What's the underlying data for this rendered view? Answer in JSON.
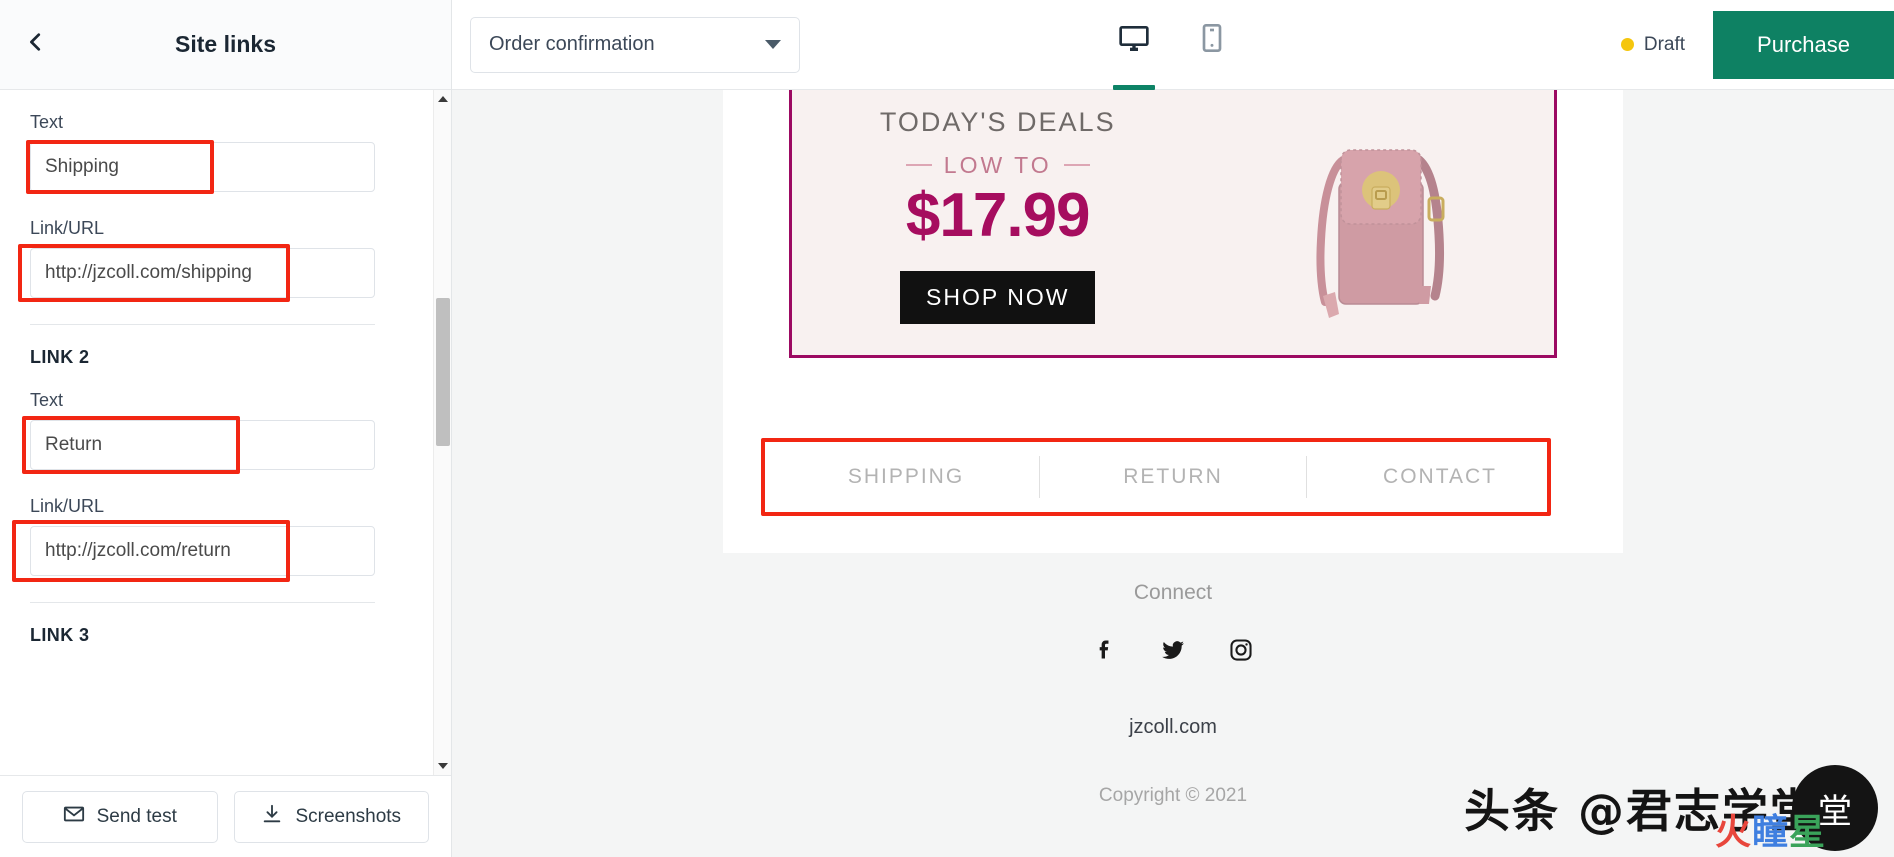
{
  "panel": {
    "title": "Site links",
    "back_icon": "chevron-left-icon",
    "fields": [
      {
        "label": "Text",
        "value": "Shipping"
      },
      {
        "label": "Link/URL",
        "value": "http://jzcoll.com/shipping"
      }
    ],
    "link2_heading": "LINK 2",
    "link2_fields": [
      {
        "label": "Text",
        "value": "Return"
      },
      {
        "label": "Link/URL",
        "value": "http://jzcoll.com/return"
      }
    ],
    "link3_heading": "LINK 3",
    "footer": {
      "send_test": "Send test",
      "send_test_icon": "envelope-icon",
      "screenshots": "Screenshots",
      "screenshots_icon": "download-icon"
    }
  },
  "toolbar": {
    "template_selected": "Order confirmation",
    "dropdown_icon": "chevron-down-icon",
    "desktop_icon": "desktop-icon",
    "mobile_icon": "mobile-icon",
    "status_label": "Draft",
    "status_color": "#f5c60d",
    "purchase_label": "Purchase",
    "purchase_color": "#0e8163",
    "active_indicator_color": "#0d8366"
  },
  "preview": {
    "banner": {
      "headline": "TODAY'S DEALS",
      "subhead": "LOW  TO",
      "price": "$17.99",
      "cta": "SHOP NOW",
      "border_color": "#9c0a62",
      "bg_color": "#f8f1f0",
      "product_alt": "pink-crossbody-bag"
    },
    "footer_links": [
      "SHIPPING",
      "RETURN",
      "CONTACT"
    ],
    "connect_label": "Connect",
    "social": [
      {
        "name": "facebook-icon"
      },
      {
        "name": "twitter-icon"
      },
      {
        "name": "instagram-icon"
      }
    ],
    "site_name": "jzcoll.com",
    "copyright": "Copyright © 2021"
  },
  "watermark": {
    "text": "头条 @君志学堂",
    "badge": "堂",
    "sub": [
      "火",
      "瞳",
      "星"
    ]
  }
}
